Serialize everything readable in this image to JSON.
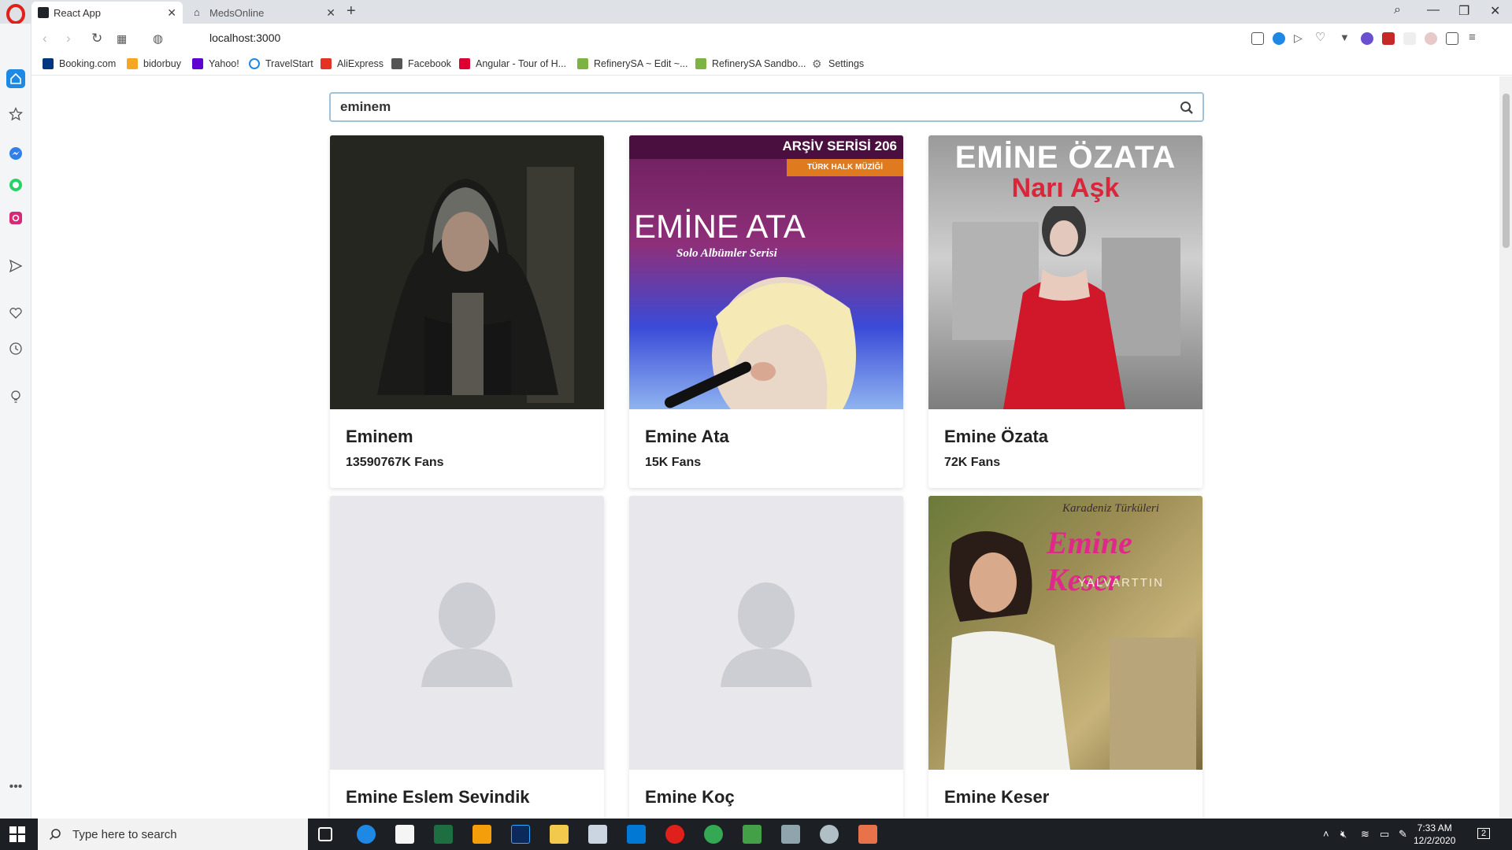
{
  "browser": {
    "tabs": [
      {
        "title": "React App",
        "active": true
      },
      {
        "title": "MedsOnline",
        "active": false
      }
    ],
    "url": "localhost:3000",
    "bookmarks": [
      {
        "label": "Booking.com",
        "color": "#003580"
      },
      {
        "label": "bidorbuy",
        "color": "#f5a623"
      },
      {
        "label": "Yahoo!",
        "color": "#5f01d1"
      },
      {
        "label": "TravelStart",
        "color": "#1e88e5"
      },
      {
        "label": "AliExpress",
        "color": "#e43225"
      },
      {
        "label": "Facebook",
        "color": "#555555"
      },
      {
        "label": "Angular - Tour of H...",
        "color": "#dd0031"
      },
      {
        "label": "RefinerySA ~ Edit ~...",
        "color": "#7cb342"
      },
      {
        "label": "RefinerySA Sandbo...",
        "color": "#7cb342"
      },
      {
        "label": "Settings",
        "color": "#666666"
      }
    ]
  },
  "search": {
    "value": "eminem",
    "icon": "search-icon"
  },
  "artists": [
    {
      "name": "Eminem",
      "fans": "13590767K Fans"
    },
    {
      "name": "Emine Ata",
      "fans": "15K Fans"
    },
    {
      "name": "Emine Özata",
      "fans": "72K Fans"
    },
    {
      "name": "Emine Eslem Sevindik",
      "fans": ""
    },
    {
      "name": "Emine Koç",
      "fans": ""
    },
    {
      "name": "Emine Keser",
      "fans": ""
    }
  ],
  "cover_text": {
    "ata_series": "ARŞİV SERİSİ 206",
    "ata_sub": "TÜRK HALK MÜZİĞİ",
    "ata_name": "EMİNE ATA",
    "ata_album": "Solo Albümler Serisi",
    "ozata_name": "EMİNE ÖZATA",
    "ozata_album": "Narı Aşk",
    "keser_top": "Karadeniz Türküleri",
    "keser_name": "Emine Keser",
    "keser_album": "YALVARTTIN"
  },
  "taskbar": {
    "search_placeholder": "Type here to search",
    "time": "7:33 AM",
    "date": "12/2/2020",
    "notifications": "2"
  },
  "colors": {
    "accent_sidebar": "#1e88e5",
    "search_border": "#9ec3d8"
  }
}
